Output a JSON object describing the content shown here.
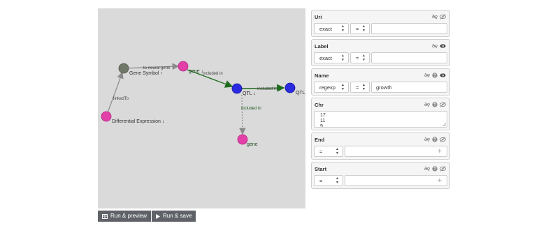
{
  "graph": {
    "nodes": [
      {
        "id": "diffexp",
        "label": "Differential Expression ↓",
        "color": "#e23fa8",
        "outline": "#b42a84"
      },
      {
        "id": "genesym",
        "label": "Gene Symbol ↑",
        "color": "#6f7868",
        "outline": "#555c50"
      },
      {
        "id": "gene1",
        "label": "gene ↓",
        "color": "#e23fa8",
        "outline": "#b42a84"
      },
      {
        "id": "qtl1",
        "label": "QTL ↓",
        "color": "#2a2ae0",
        "outline": "#1818a0"
      },
      {
        "id": "qtl2",
        "label": "QTL",
        "color": "#2a2ae0",
        "outline": "#1818a0"
      },
      {
        "id": "gene2",
        "label": "gene",
        "color": "#e23fa8",
        "outline": "#b42a84"
      }
    ],
    "edges": [
      {
        "label": "linkedTo"
      },
      {
        "label": "to neural gene"
      },
      {
        "label": "included in"
      },
      {
        "label": "included in"
      },
      {
        "label": "included in"
      }
    ]
  },
  "buttons": {
    "run_preview": "Run & preview",
    "run_save": "Run & save"
  },
  "filters": {
    "uri": {
      "title": "Uri",
      "match": "exact",
      "op": "=",
      "value": ""
    },
    "label": {
      "title": "Label",
      "match": "exact",
      "op": "=",
      "value": ""
    },
    "name": {
      "title": "Name",
      "match": "regexp",
      "op": "=",
      "value": "growth"
    },
    "chr": {
      "title": "Chr",
      "lines": [
        "17",
        "11",
        "9"
      ]
    },
    "end": {
      "title": "End",
      "op": "="
    },
    "start": {
      "title": "Start",
      "op": "="
    }
  },
  "icons": {
    "unlink": "unlink-icon",
    "help": "question-circle-icon",
    "eye": "eye-icon",
    "eye_slash": "eye-slash-icon",
    "table": "table-icon",
    "play": "play-icon"
  }
}
